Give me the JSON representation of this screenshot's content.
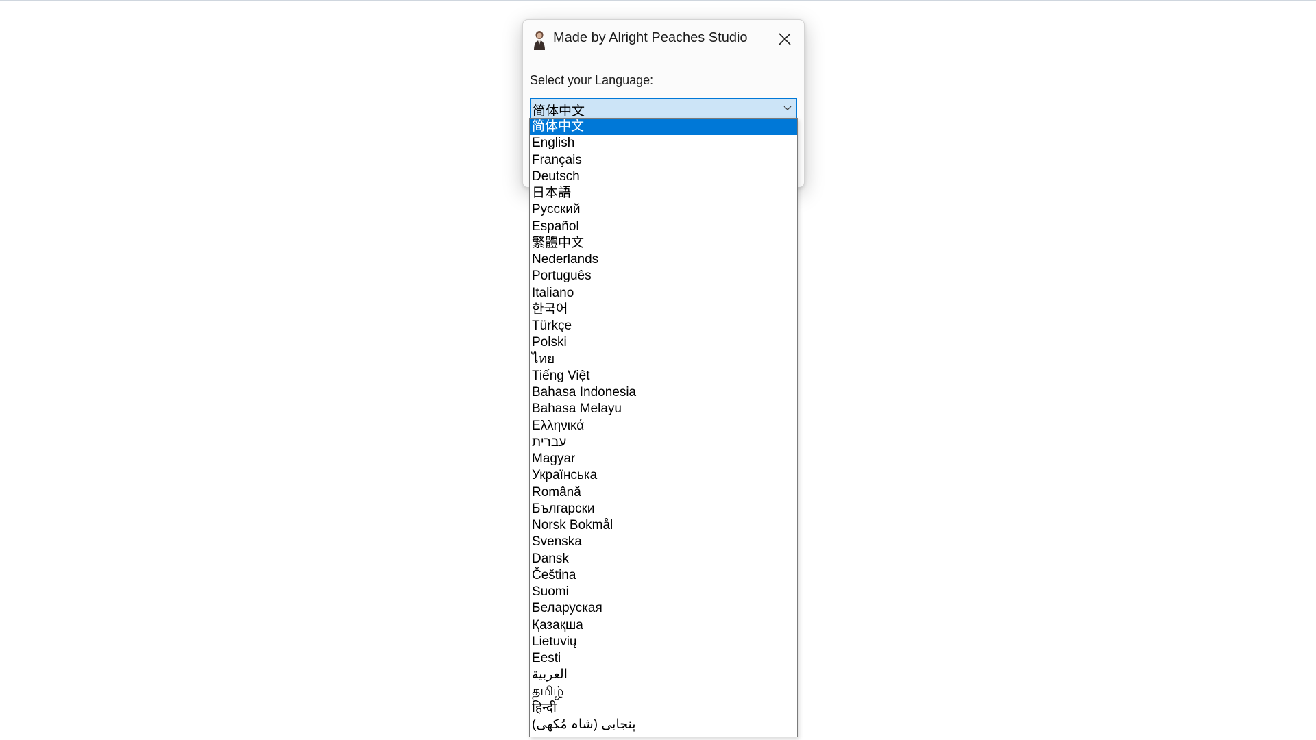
{
  "window": {
    "title": "Made by Alright Peaches Studio",
    "icon": "peach-avatar-icon",
    "close_icon": "close-icon"
  },
  "language_prompt": "Select your Language:",
  "language_select": {
    "selected_value": "简体中文",
    "selected_index": 0,
    "options": [
      "简体中文",
      "English",
      "Français",
      "Deutsch",
      "日本語",
      "Русский",
      "Español",
      "繁體中文",
      "Nederlands",
      "Português",
      "Italiano",
      "한국어",
      "Türkçe",
      "Polski",
      "ไทย",
      "Tiếng Việt",
      "Bahasa Indonesia",
      "Bahasa Melayu",
      "Ελληνικά",
      "עברית",
      "Magyar",
      "Українська",
      "Română",
      "Български",
      "Norsk Bokmål",
      "Svenska",
      "Dansk",
      "Čeština",
      "Suomi",
      "Беларуская",
      "Қазақша",
      "Lietuvių",
      "Eesti",
      "العربية",
      "தமிழ்",
      "हिन्दी",
      "پنجابی (شاہ مُکھی)"
    ]
  },
  "colors": {
    "accent": "#0078d7",
    "combo_background": "#cce4f7",
    "dialog_background": "#fbfbfb"
  }
}
